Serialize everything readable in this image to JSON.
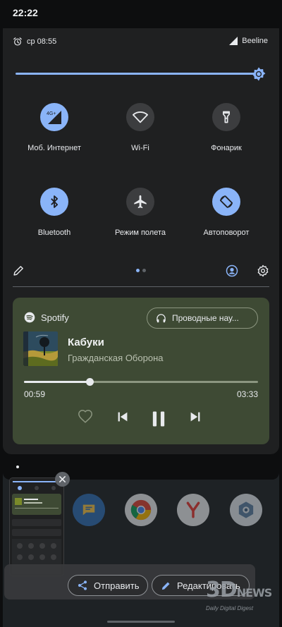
{
  "status_bar": {
    "time": "22:22"
  },
  "shade": {
    "alarm": "ср 08:55",
    "carrier": "Beeline",
    "brightness_level": 0.98,
    "tiles": [
      {
        "id": "mobile-data",
        "label": "Моб. Интернет",
        "badge": "4G+",
        "active": true,
        "icon": "signal-icon"
      },
      {
        "id": "wifi",
        "label": "Wi-Fi",
        "active": false,
        "icon": "wifi-icon"
      },
      {
        "id": "flashlight",
        "label": "Фонарик",
        "active": false,
        "icon": "flashlight-icon"
      },
      {
        "id": "bluetooth",
        "label": "Bluetooth",
        "active": true,
        "icon": "bluetooth-icon"
      },
      {
        "id": "airplane",
        "label": "Режим полета",
        "active": false,
        "icon": "airplane-icon"
      },
      {
        "id": "autorotate",
        "label": "Автоповорот",
        "active": true,
        "icon": "autorotate-icon"
      }
    ],
    "page_count": 2,
    "current_page": 1
  },
  "media": {
    "app": "Spotify",
    "output": "Проводные нау...",
    "title": "Кабуки",
    "artist": "Гражданская Оборона",
    "elapsed": "00:59",
    "duration": "03:33",
    "progress": 0.28
  },
  "recents": {
    "share_label": "Отправить",
    "edit_label": "Редактировать"
  },
  "watermark": {
    "logo": "3D",
    "logo_suffix": "NEWS",
    "tagline": "Daily Digital Digest"
  },
  "colors": {
    "accent": "#8ab4f8",
    "media_card": "#3e4a34",
    "shade": "#1f2021"
  }
}
